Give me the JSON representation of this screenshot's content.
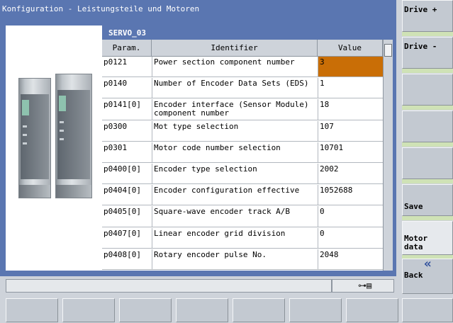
{
  "window": {
    "title": "Konfiguration - Leistungsteile und Motoren"
  },
  "table": {
    "title": "SERVO_03",
    "columns": {
      "param": "Param.",
      "identifier": "Identifier",
      "value": "Value"
    },
    "rows": [
      {
        "param": "p0121",
        "identifier": "Power section component number",
        "value": "3",
        "selected": true
      },
      {
        "param": "p0140",
        "identifier": "Number of Encoder Data Sets (EDS)",
        "value": "1"
      },
      {
        "param": "p0141[0]",
        "identifier": "Encoder interface (Sensor Module) component number",
        "value": "18"
      },
      {
        "param": "p0300",
        "identifier": "Mot type selection",
        "value": "107"
      },
      {
        "param": "p0301",
        "identifier": "Motor code number selection",
        "value": "10701"
      },
      {
        "param": "p0400[0]",
        "identifier": "Encoder type selection",
        "value": "2002"
      },
      {
        "param": "p0404[0]",
        "identifier": "Encoder configuration effective",
        "value": "1052688"
      },
      {
        "param": "p0405[0]",
        "identifier": "Square-wave encoder track A/B",
        "value": "0"
      },
      {
        "param": "p0407[0]",
        "identifier": "Linear encoder grid division",
        "value": "0"
      },
      {
        "param": "p0408[0]",
        "identifier": "Rotary encoder pulse No.",
        "value": "2048"
      }
    ]
  },
  "vertical_softkeys": [
    {
      "label": "Drive +"
    },
    {
      "label": "Drive -"
    },
    {
      "label": ""
    },
    {
      "label": ""
    },
    {
      "label": ""
    },
    {
      "label": "Save"
    },
    {
      "label": "Motor\ndata"
    },
    {
      "label": "Back",
      "icon": "double-chevron-left-icon"
    }
  ],
  "horizontal_softkeys": [
    "",
    "",
    "",
    "",
    "",
    "",
    "",
    ""
  ],
  "status": {
    "message": "",
    "icon": "network-connection-icon"
  },
  "colors": {
    "frame_blue": "#5a76b1",
    "selected_value": "#c96e06",
    "softkey_gray": "#c3c9d1",
    "softkey_separator": "#cfe2b6"
  }
}
